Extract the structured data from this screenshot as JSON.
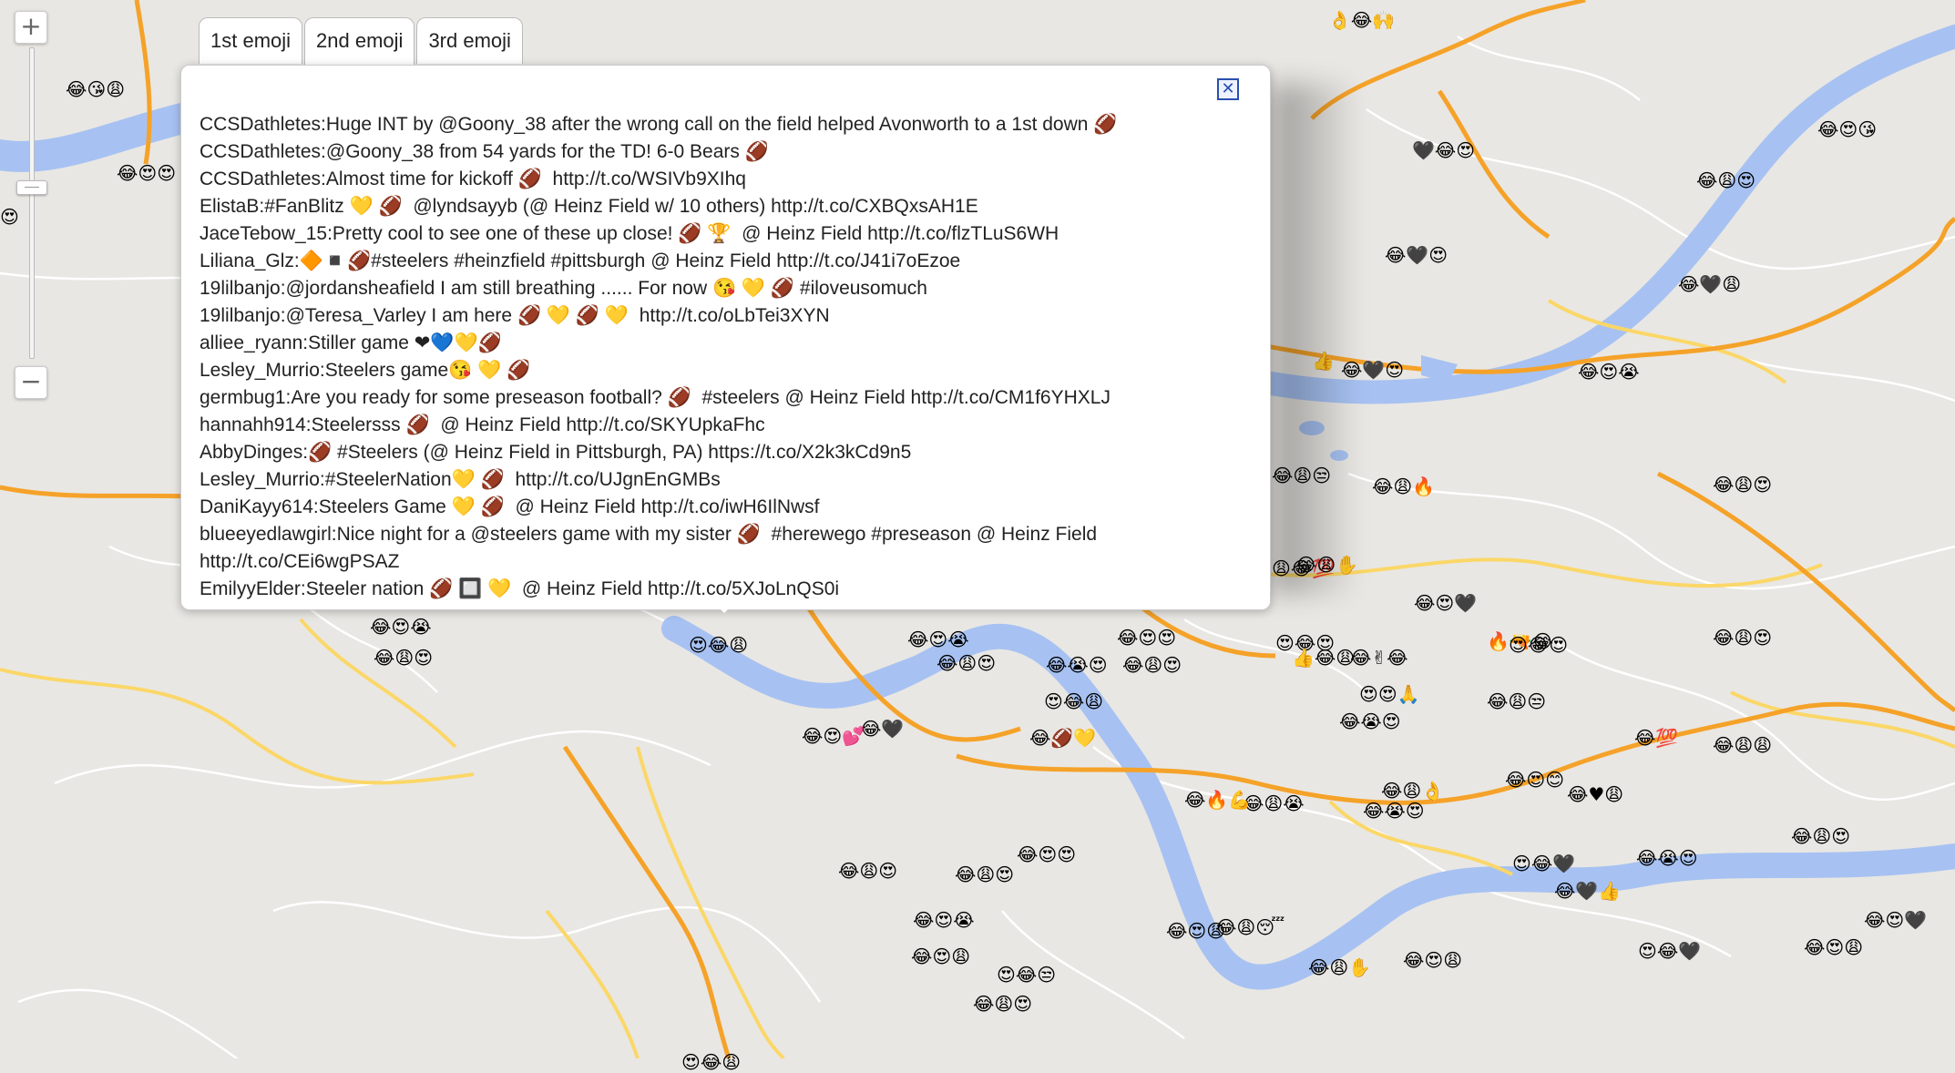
{
  "zoom": {
    "plus_label": "+",
    "minus_label": "−"
  },
  "popup": {
    "tabs": [
      "1st emoji",
      "2nd emoji",
      "3rd emoji"
    ],
    "active_tab": 1,
    "close_label": "✕",
    "tweets": [
      "CCSDathletes:Huge INT by @Goony_38 after the wrong call on the field helped Avonworth to a 1st down 🏈",
      "CCSDathletes:@Goony_38 from 54 yards for the TD! 6-0 Bears 🏈",
      "CCSDathletes:Almost time for kickoff 🏈  http://t.co/WSIVb9XIhq",
      "ElistaB:#FanBlitz 💛 🏈  @lyndsayyb (@ Heinz Field w/ 10 others) http://t.co/CXBQxsAH1E",
      "JaceTebow_15:Pretty cool to see one of these up close! 🏈 🏆  @ Heinz Field http://t.co/flzTLuS6WH",
      "Liliana_Glz:🔶◾🏈#steelers #heinzfield #pittsburgh @ Heinz Field http://t.co/J41i7oEzoe",
      "19lilbanjo:@jordansheafield I am still breathing ...... For now 😘 💛 🏈 #iloveusomuch",
      "19lilbanjo:@Teresa_Varley I am here 🏈 💛 🏈 💛  http://t.co/oLbTei3XYN",
      "alliee_ryann:Stiller game ❤💙💛🏈",
      "Lesley_Murrio:Steelers game😘 💛 🏈",
      "germbug1:Are you ready for some preseason football? 🏈  #steelers @ Heinz Field http://t.co/CM1f6YHXLJ",
      "hannahh914:Steelersss 🏈  @ Heinz Field http://t.co/SKYUpkaFhc",
      "AbbyDinges:🏈 #Steelers (@ Heinz Field in Pittsburgh, PA) https://t.co/X2k3kCd9n5",
      "Lesley_Murrio:#SteelerNation💛 🏈  http://t.co/UJgnEnGMBs",
      "DaniKayy614:Steelers Game 💛 🏈  @ Heinz Field http://t.co/iwH6IlNwsf",
      "blueeyedlawgirl:Nice night for a @steelers game with my sister 🏈  #herewego #preseason @ Heinz Field http://t.co/CEi6wgPSAZ",
      "EmilyyElder:Steeler nation 🏈 🔲 💛  @ Heinz Field http://t.co/5XJoLnQS0i"
    ]
  },
  "map": {
    "colors": {
      "land": "#e9e7e3",
      "river": "#a7c2f2",
      "highway": "#f5a229",
      "major_road": "#fbd768",
      "minor_road": "#ffffff"
    },
    "markers": [
      "😂😘😩",
      "😂😍😍",
      "😍",
      "👌😂🙌",
      "😂😍😘",
      "🖤😂😍",
      "😂😩😍",
      "😂🖤😍",
      "😂🖤😩",
      "👍",
      "😂🖤😍",
      "😂😍😭",
      "😂😩😒",
      "😂😩🔥",
      "😂😩😍",
      "😩😂💯",
      "😂😩✋",
      "😂😍🖤",
      "😍😂😍",
      "😂😩😍",
      "👍😂😩",
      "🔥🔫😂",
      "😍😍🙏",
      "😂😩😒",
      "😂😭😍",
      "😍😂😍",
      "😂😍😊",
      "😂😩👌",
      "😂😩😭",
      "😂😭😍",
      "😂🔥💪",
      "😂😩😩",
      "😂💯",
      "😂♥😩",
      "😂😭😍",
      "😍😂🖤",
      "😂😩😍",
      "😂🖤👍",
      "😂😍🖤",
      "😂😍😩",
      "😍😂🖤",
      "😂😍😩",
      "😂😩✋",
      "😂😩😴",
      "😂😍😩",
      "😍😂😒",
      "😂😩😍",
      "😂😍😍",
      "😂🏈💛",
      "😍😂😩",
      "😂😍😭",
      "😂😩😍",
      "😂🖤",
      "😂😍💕",
      "😍😂😩",
      "😂😩😍",
      "😂😍😭",
      "😂😩😍",
      "😂😍😍",
      "😂😩😍",
      "😍😂😩",
      "😂😭😍",
      "😂😍😩",
      "😂✌😂",
      "😂😍😭",
      "😂😩😍"
    ]
  }
}
